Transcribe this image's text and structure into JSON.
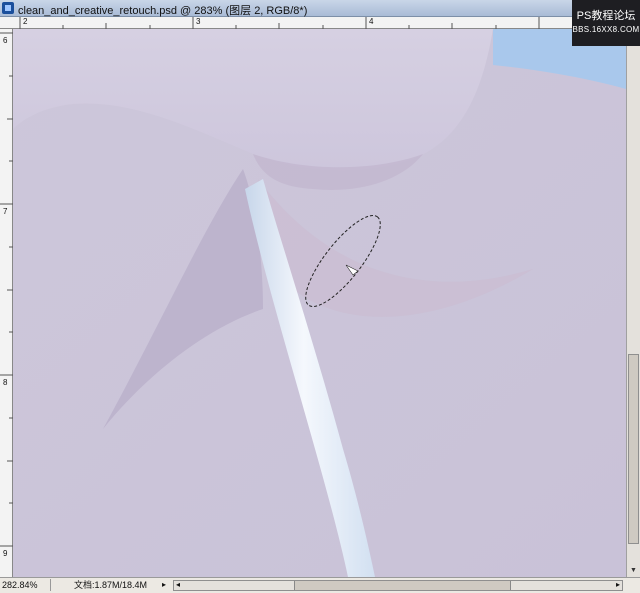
{
  "window": {
    "title": "clean_and_creative_retouch.psd @ 283% (图层 2, RGB/8*)"
  },
  "watermark": {
    "line1": "PS教程论坛",
    "line2": "BBS.16XX8.COM"
  },
  "rulers": {
    "top": [
      {
        "label": "2"
      },
      {
        "label": "3"
      },
      {
        "label": "4"
      }
    ],
    "left": [
      {
        "label": "6"
      },
      {
        "label": "7"
      },
      {
        "label": "8"
      },
      {
        "label": "9"
      }
    ]
  },
  "status": {
    "zoom": "282.84%",
    "doc_size": "文档:1.87M/18.4M",
    "arrow_left": "◂",
    "arrow_right": "▸",
    "status_arrow": "▸"
  },
  "scroll": {
    "up": "▲",
    "down": "▼"
  },
  "colors": {
    "skin": "#cfc8dc",
    "strap": "#f2f6fb",
    "shadow": "#b8aec7",
    "sky": "#9fc7ee"
  },
  "icons": {
    "document": "psd-document-icon",
    "selection": "lasso-selection-outline"
  }
}
